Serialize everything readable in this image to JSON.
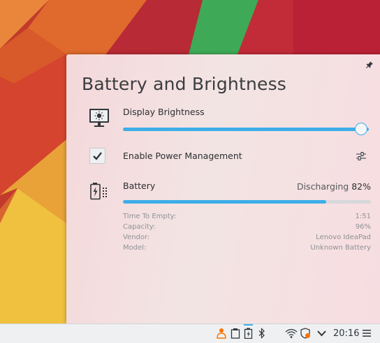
{
  "popup": {
    "title": "Battery and Brightness",
    "brightness": {
      "label": "Display Brightness",
      "level": 1.0
    },
    "power_management": {
      "label": "Enable Power Management",
      "checked": true
    },
    "battery": {
      "label": "Battery",
      "state": "Discharging",
      "percent_text": "82%",
      "level": 0.82,
      "details": [
        {
          "key": "Time To Empty:",
          "value": "1:51"
        },
        {
          "key": "Capacity:",
          "value": "96%"
        },
        {
          "key": "Vendor:",
          "value": "Lenovo IdeaPad"
        },
        {
          "key": "Model:",
          "value": "Unknown Battery"
        }
      ]
    }
  },
  "panel": {
    "clock": "20:16",
    "tray_icons": [
      "user-icon",
      "clipboard-icon",
      "battery-icon",
      "bluetooth-icon",
      "wifi-icon",
      "updates-icon",
      "expand-tray-icon",
      "menu-icon"
    ]
  },
  "colors": {
    "accent": "#3daee9",
    "track": "#d6d8db"
  }
}
